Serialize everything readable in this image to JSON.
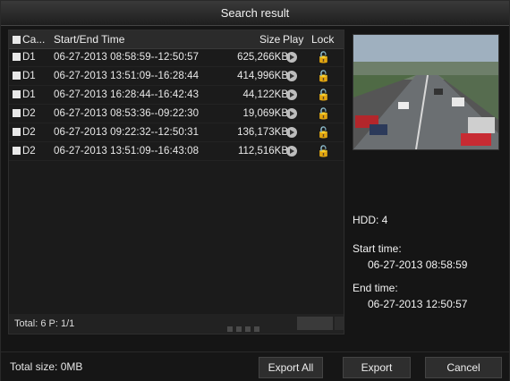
{
  "title": "Search result",
  "table": {
    "headers": {
      "camera": "Ca...",
      "time": "Start/End Time",
      "size": "Size",
      "play": "Play",
      "lock": "Lock"
    },
    "rows": [
      {
        "camera": "D1",
        "time": "06-27-2013 08:58:59--12:50:57",
        "size": "625,266KB"
      },
      {
        "camera": "D1",
        "time": "06-27-2013 13:51:09--16:28:44",
        "size": "414,996KB"
      },
      {
        "camera": "D1",
        "time": "06-27-2013 16:28:44--16:42:43",
        "size": "44,122KB"
      },
      {
        "camera": "D2",
        "time": "06-27-2013 08:53:36--09:22:30",
        "size": "19,069KB"
      },
      {
        "camera": "D2",
        "time": "06-27-2013 09:22:32--12:50:31",
        "size": "136,173KB"
      },
      {
        "camera": "D2",
        "time": "06-27-2013 13:51:09--16:43:08",
        "size": "112,516KB"
      }
    ]
  },
  "footer": {
    "total": "Total: 6  P: 1/1"
  },
  "info": {
    "hdd": "HDD: 4",
    "start_label": "Start time:",
    "start_value": "06-27-2013 08:58:59",
    "end_label": "End time:",
    "end_value": "06-27-2013 12:50:57"
  },
  "bottom": {
    "total_size": "Total size: 0MB",
    "export_all": "Export All",
    "export": "Export",
    "cancel": "Cancel"
  },
  "icons": {
    "play": "play-icon",
    "lock": "unlock-icon"
  }
}
